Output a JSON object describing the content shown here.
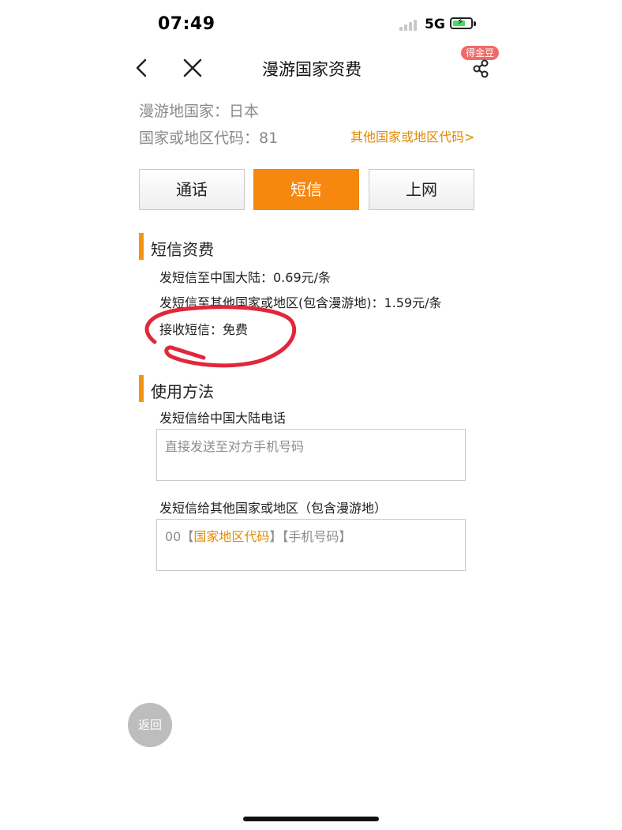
{
  "status_bar": {
    "time": "07:49",
    "network": "5G"
  },
  "nav": {
    "title": "漫游国家资费",
    "badge": "得金豆"
  },
  "info": {
    "country": "漫游地国家：日本",
    "code": "国家或地区代码：81",
    "other_code_link": "其他国家或地区代码>"
  },
  "tabs": [
    {
      "label": "通话",
      "active": false
    },
    {
      "label": "短信",
      "active": true
    },
    {
      "label": "上网",
      "active": false
    }
  ],
  "sms_fees": {
    "title": "短信资费",
    "items": [
      "发短信至中国大陆：0.69元/条",
      "发短信至其他国家或地区(包含漫游地)：1.59元/条",
      "接收短信：免费"
    ]
  },
  "usage": {
    "title": "使用方法",
    "mainland_label": "发短信给中国大陆电话",
    "mainland_hint": "直接发送至对方手机号码",
    "other_label": "发短信给其他国家或地区（包含漫游地）",
    "other_hint": {
      "prefix": "00【",
      "highlight": "国家地区代码",
      "suffix": "】【手机号码】"
    }
  },
  "back_button": "返回",
  "colors": {
    "accent": "#f6870f",
    "link": "#e08a00",
    "annotation": "#e0283a"
  }
}
